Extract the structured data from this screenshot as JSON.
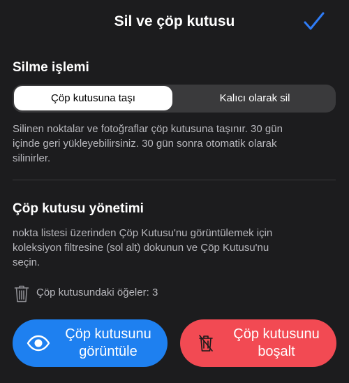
{
  "header": {
    "title": "Sil ve çöp kutusu",
    "done_icon": "checkmark-icon"
  },
  "delete_action": {
    "title": "Silme işlemi",
    "options": [
      "Çöp kutusuna taşı",
      "Kalıcı olarak sil"
    ],
    "selected": "Çöp kutusuna taşı",
    "description_lines": [
      "Silinen noktalar ve fotoğraflar çöp kutusuna taşınır. 30 gün",
      "içinde geri yükleyebilirsiniz. 30 gün sonra otomatik olarak",
      "silinirler."
    ]
  },
  "trash_management": {
    "title": "Çöp kutusu yönetimi",
    "description_lines": [
      "nokta listesi üzerinden Çöp Kutusu'nu görüntülemek için",
      "koleksiyon filtresine (sol alt) dokunun ve Çöp Kutusu'nu",
      "seçin."
    ],
    "items_label": "Çöp kutusundaki öğeler: 3",
    "items_icon": "trash-icon"
  },
  "buttons": {
    "view": {
      "line1": "Çöp kutusunu",
      "line2": "görüntüle",
      "icon": "eye-icon",
      "color": "#1e80f0"
    },
    "empty": {
      "line1": "Çöp kutusunu",
      "line2": "boşalt",
      "icon": "trash-slash-icon",
      "color": "#f24a53"
    }
  },
  "colors": {
    "background": "#1c1c1e",
    "accent": "#2f7cf6",
    "secondary_text": "#b8b8bd"
  }
}
